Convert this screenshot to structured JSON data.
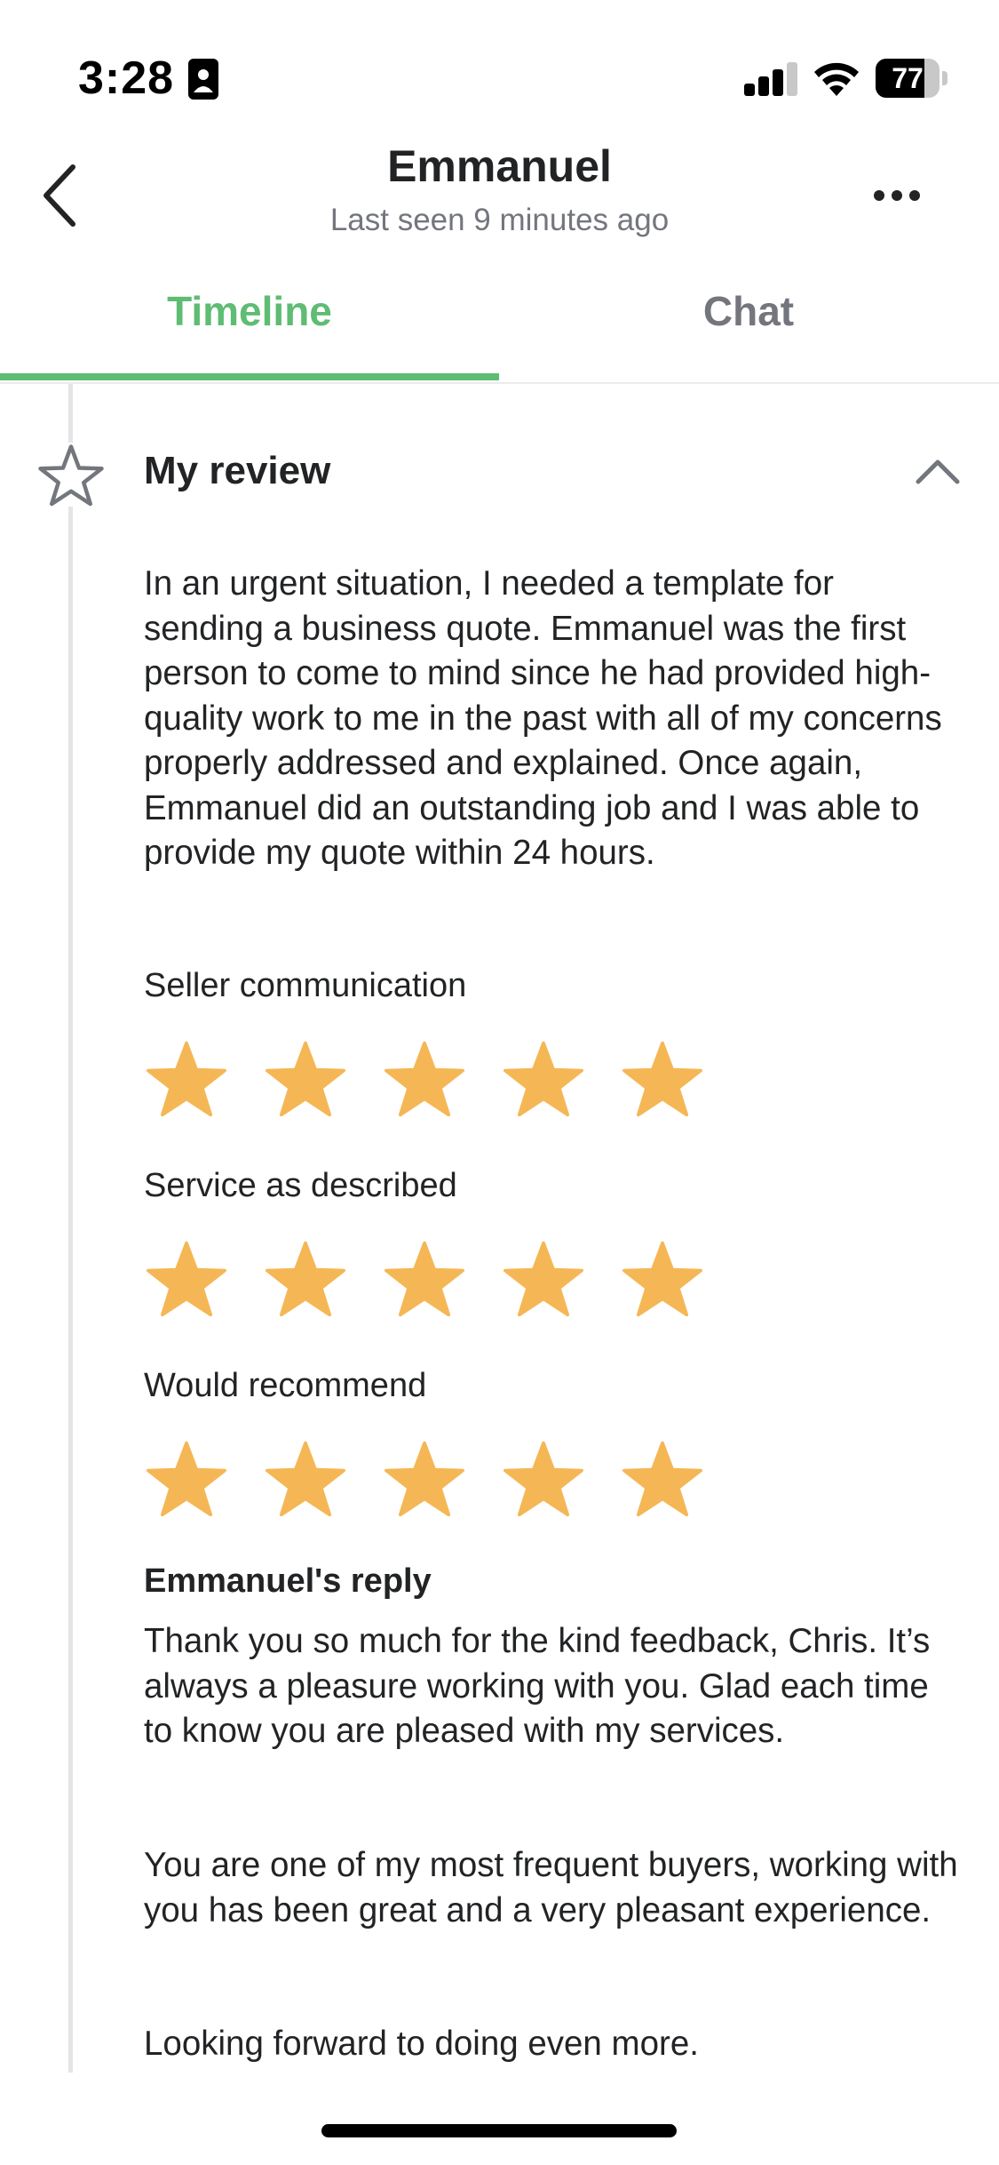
{
  "status_bar": {
    "time": "3:28",
    "battery_level": "77",
    "battery_fraction": 0.77
  },
  "header": {
    "title": "Emmanuel",
    "subtitle": "Last seen 9 minutes ago"
  },
  "tabs": [
    {
      "label": "Timeline",
      "active": true
    },
    {
      "label": "Chat",
      "active": false
    }
  ],
  "review": {
    "title": "My review",
    "text": "In an urgent situation, I needed a template for sending a business quote. Emmanuel was the first person to come to mind since he had provided high-quality work to me in the past with all of my concerns properly addressed and explained. Once again, Emmanuel did an outstanding job and I was able to provide my quote within 24 hours.",
    "ratings": [
      {
        "label": "Seller communication",
        "stars": 5,
        "max": 5
      },
      {
        "label": "Service as described",
        "stars": 5,
        "max": 5
      },
      {
        "label": "Would recommend",
        "stars": 5,
        "max": 5
      }
    ],
    "reply": {
      "title": "Emmanuel's reply",
      "paragraphs": [
        "Thank you so much for the kind feedback, Chris. It’s always a pleasure working with you. Glad each time to know you are pleased with my services.",
        "You are one of my most frequent buyers, working with you has been great and a very pleasant experience.",
        "Looking forward to doing even more."
      ]
    }
  },
  "icons": {
    "back": "chevron-left-icon",
    "more": "more-dots-icon",
    "review_marker": "star-outline-icon",
    "collapse": "chevron-up-icon",
    "rating_star": "star-filled-icon"
  },
  "colors": {
    "accent": "#5ebc73",
    "star": "#f5b755",
    "muted_text": "#74767e",
    "text": "#222325"
  }
}
